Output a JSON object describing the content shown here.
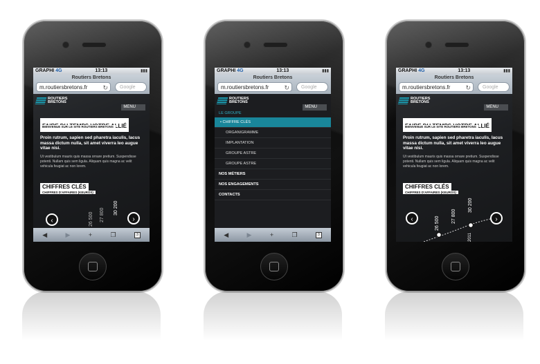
{
  "status": {
    "carrier": "GRAPHI",
    "network": "4G",
    "time": "13:13"
  },
  "browser": {
    "page_title": "Routiers Bretons",
    "url": "m.routiersbretons.fr",
    "search_placeholder": "Google"
  },
  "site": {
    "logo_line1": "ROUTIERS",
    "logo_line2": "BRETONS",
    "menu_label": "MENU",
    "tagline": "FAIRE DU TEMPS VOTRE ALLIÉ",
    "tagline_sub": "BIENVENUE SUR LE SITE ROUTIERS BRETONS",
    "lead": "Proin rutrum, sapien sed pharetra iaculis, lacus massa dictum nulla, sit amet viverra leo augue vitae nisi.",
    "body": "Ut vestibulum mauris quis massa ornare pretium. Suspendisse potenti. Nullam quis sem ligula. Aliquam quis magna ac velit vehicula feugiat ac non lorem.",
    "chiffres_title": "CHIFFRES CLÉS",
    "chiffres_sub": "CHIFFRES D'AFFAIRES (KEUROS)",
    "chart_values_screen1": [
      "26 500",
      "27 800",
      "30 200"
    ],
    "chart_values_screen3": [
      "26 500",
      "27 800",
      "30 200"
    ],
    "year_label": "2011",
    "prev_arrow": "‹",
    "next_arrow": "›"
  },
  "nav_menu": {
    "group_label": "LE GROUPE",
    "items": [
      "CHIFFRE CLÉS",
      "ORGANIGRAMME",
      "IMPLANTATION",
      "GROUPE ASTRE",
      "GROUPE ASTRE"
    ],
    "top_items": [
      "NOS MÉTIERS",
      "NOS ENGAGEMENTS",
      "CONTACTS"
    ]
  },
  "toolbar": {
    "back": "◀",
    "forward": "▶",
    "add": "+",
    "bookmarks": "📖",
    "pages": "3"
  }
}
